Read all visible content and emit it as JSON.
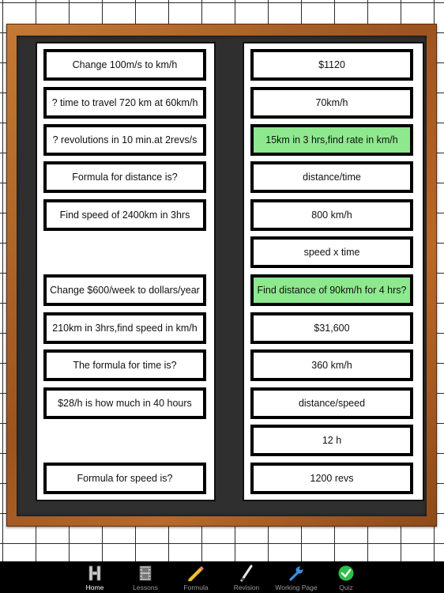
{
  "left_cards": [
    "Change 100m/s to km/h",
    "? time to travel 720 km at 60km/h",
    "? revolutions in 10 min.at 2revs/s",
    "Formula for distance is?",
    "Find speed of 2400km in 3hrs",
    "",
    "Change $600/week to dollars/year",
    "210km in 3hrs,find speed in km/h",
    "The formula for time is?",
    "$28/h is how much in 40 hours",
    "",
    "Formula for speed is?"
  ],
  "right_cards": [
    "$1120",
    "70km/h",
    "15km in 3 hrs,find rate in km/h",
    "distance/time",
    "800 km/h",
    "speed x time",
    "Find distance of 90km/h for 4 hrs?",
    "$31,600",
    "360 km/h",
    "distance/speed",
    "12 h",
    "1200 revs"
  ],
  "right_selected": [
    2,
    6
  ],
  "colors": {
    "selected": "#8ee88e",
    "board": "#2f2f2f",
    "frame": "#a85d24",
    "check": "#2fbf4a",
    "wrench": "#3b8fe0"
  },
  "tabs": [
    {
      "label": "Home",
      "icon": "home-icon"
    },
    {
      "label": "Lessons",
      "icon": "film-icon"
    },
    {
      "label": "Formula",
      "icon": "pencil-icon"
    },
    {
      "label": "Revision",
      "icon": "pen-icon"
    },
    {
      "label": "Working Page",
      "icon": "wrench-icon"
    },
    {
      "label": "Quiz",
      "icon": "checkmark-icon"
    }
  ],
  "active_tab": "Home"
}
